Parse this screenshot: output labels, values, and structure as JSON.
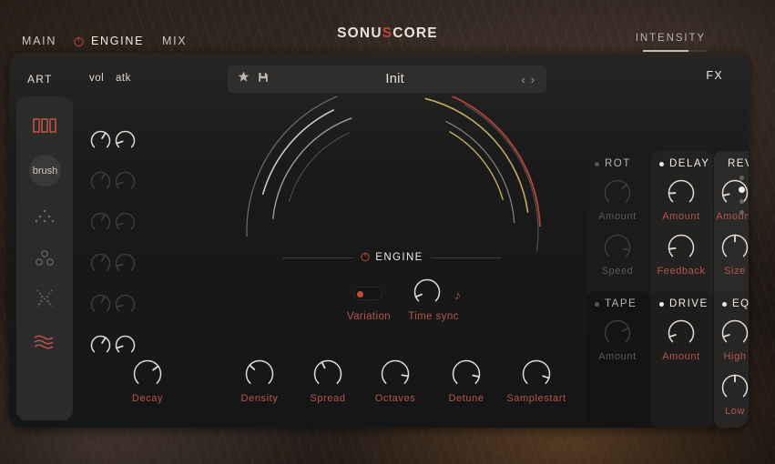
{
  "app": {
    "logo_prefix": "SONU",
    "logo_accent": "S",
    "logo_suffix": "CORE"
  },
  "colors": {
    "accent_red": "#b5564a",
    "accent_red_bright": "#c64a3c",
    "text_primary": "#efe9e4",
    "text_dim": "#6f6a67",
    "arc_yellow": "#c9b464",
    "arc_red": "#c04a3a",
    "panel_bg": "#1b1a1a"
  },
  "tabs": [
    {
      "label": "MAIN",
      "active": false,
      "icon": ""
    },
    {
      "label": "ENGINE",
      "active": true,
      "icon": "power-icon"
    },
    {
      "label": "MIX",
      "active": false,
      "icon": ""
    }
  ],
  "intensity": {
    "label": "INTENSITY",
    "value_pct": 72
  },
  "header": {
    "art_label": "ART",
    "vol_label": "vol",
    "atk_label": "atk",
    "fx_label": "FX"
  },
  "preset": {
    "name": "Init",
    "favorite_icon": "star-icon",
    "save_icon": "save-icon",
    "prev_icon": "chevron-left-icon",
    "next_icon": "chevron-right-icon"
  },
  "articulations": [
    {
      "name": "bars-icon",
      "label": "",
      "active": true
    },
    {
      "name": "brush-icon",
      "label": "brush",
      "active": false
    },
    {
      "name": "dots-small-icon",
      "label": "",
      "active": false
    },
    {
      "name": "circles-icon",
      "label": "",
      "active": false
    },
    {
      "name": "cross-icon",
      "label": "",
      "active": false
    },
    {
      "name": "waves-icon",
      "label": "",
      "active": true
    }
  ],
  "voice_rows": [
    {
      "vol": 0.62,
      "atk": 0.1,
      "active": true
    },
    {
      "vol": 0.6,
      "atk": 0.1,
      "active": false
    },
    {
      "vol": 0.6,
      "atk": 0.1,
      "active": false
    },
    {
      "vol": 0.6,
      "atk": 0.1,
      "active": false
    },
    {
      "vol": 0.6,
      "atk": 0.1,
      "active": false
    },
    {
      "vol": 0.62,
      "atk": 0.1,
      "active": true
    }
  ],
  "engine": {
    "title": "ENGINE",
    "power_icon": "power-icon",
    "variation": {
      "label": "Variation",
      "on": true
    },
    "time_sync": {
      "label": "Time sync",
      "value": 0.08,
      "note_icon": "note-icon"
    }
  },
  "bottom_knobs": [
    {
      "label": "Decay",
      "value": 0.7
    },
    {
      "label": "Density",
      "value": 0.32
    },
    {
      "label": "Spread",
      "value": 0.4
    },
    {
      "label": "Octaves",
      "value": 0.87
    },
    {
      "label": "Detune",
      "value": 0.88
    },
    {
      "label": "Samplestart",
      "value": 0.9
    }
  ],
  "fx": {
    "columns": [
      {
        "title": "ROT",
        "enabled": false,
        "knobs": [
          {
            "label": "Amount",
            "value": 0.68
          },
          {
            "label": "Speed",
            "value": 0.88
          }
        ]
      },
      {
        "title": "DELAY",
        "enabled": true,
        "knobs": [
          {
            "label": "Amount",
            "value": 0.16
          },
          {
            "label": "Feedback",
            "value": 0.14
          }
        ]
      },
      {
        "title": "REVERB",
        "enabled": true,
        "knobs": [
          {
            "label": "Amount",
            "value": 0.12
          },
          {
            "label": "Size",
            "value": 0.5
          }
        ]
      },
      {
        "title": "TAPE",
        "enabled": false,
        "knobs": [
          {
            "label": "Amount",
            "value": 0.75
          }
        ]
      },
      {
        "title": "DRIVE",
        "enabled": true,
        "knobs": [
          {
            "label": "Amount",
            "value": 0.1
          }
        ]
      },
      {
        "title": "EQ",
        "enabled": true,
        "knobs": [
          {
            "label": "High",
            "value": 0.1
          },
          {
            "label": "Low",
            "value": 0.5
          }
        ]
      }
    ],
    "page_dots": {
      "count": 4,
      "active_index": 1
    }
  },
  "arc_visual": {
    "type": "concentric-arcs",
    "left_arcs": [
      {
        "color": "#d8d2cd",
        "radius": 148,
        "start_deg": 196,
        "end_deg": 244,
        "width": 1.6
      },
      {
        "color": "#a8a29d",
        "radius": 132,
        "start_deg": 186,
        "end_deg": 250,
        "width": 1.4
      },
      {
        "color": "#6e6a66",
        "radius": 160,
        "start_deg": 178,
        "end_deg": 262,
        "width": 1.3
      },
      {
        "color": "#4d4a47",
        "radius": 118,
        "start_deg": 196,
        "end_deg": 246,
        "width": 1.2
      }
    ],
    "right_arcs": [
      {
        "color": "#c9b464",
        "radius": 150,
        "start_deg": 284,
        "end_deg": 352,
        "width": 1.6
      },
      {
        "color": "#c9b464",
        "radius": 126,
        "start_deg": 300,
        "end_deg": 344,
        "width": 1.4
      },
      {
        "color": "#c04a3a",
        "radius": 162,
        "start_deg": 292,
        "end_deg": 358,
        "width": 1.7
      },
      {
        "color": "#8a8682",
        "radius": 134,
        "start_deg": 296,
        "end_deg": 356,
        "width": 1.3
      },
      {
        "color": "#55514e",
        "radius": 160,
        "start_deg": 300,
        "end_deg": 368,
        "width": 1.2
      }
    ]
  }
}
